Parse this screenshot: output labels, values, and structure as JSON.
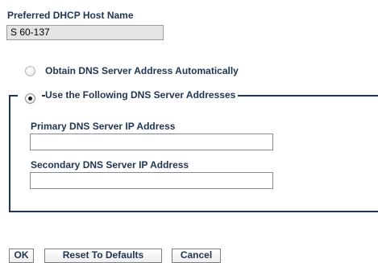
{
  "host": {
    "label": "Preferred DHCP Host Name",
    "value": "S 60-137"
  },
  "dns": {
    "auto_option_label": "Obtain DNS Server Address Automatically",
    "auto_selected": false,
    "manual_option_label": "Use the Following DNS Server Addresses",
    "manual_selected": true,
    "primary_label": "Primary DNS Server IP Address",
    "primary_value": "",
    "secondary_label": "Secondary DNS Server IP Address",
    "secondary_value": ""
  },
  "buttons": {
    "ok_label": "OK",
    "reset_label": "Reset To Defaults",
    "cancel_label": "Cancel"
  },
  "colors": {
    "label_text": "#1e3553",
    "fieldset_border": "#1e3553",
    "readonly_input_bg": "#e4e4e4"
  }
}
